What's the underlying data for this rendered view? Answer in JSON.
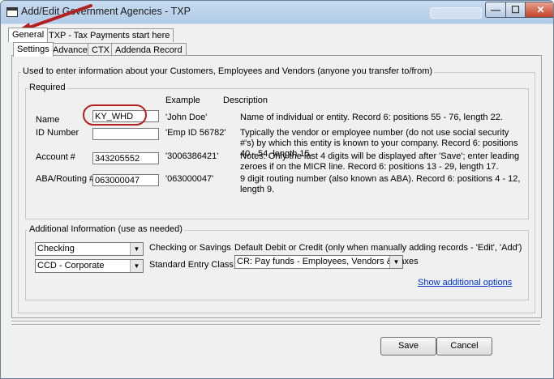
{
  "window": {
    "title": "Add/Edit Government Agencies - TXP",
    "minimize_label": "—",
    "maximize_label": "☐",
    "close_label": "✕"
  },
  "outer_tabs": [
    {
      "label": "General",
      "selected": true
    },
    {
      "label": "TXP - Tax Payments start here",
      "selected": false
    }
  ],
  "inner_tabs": [
    {
      "label": "Settings",
      "selected": true
    },
    {
      "label": "Advanced",
      "selected": false
    },
    {
      "label": "CTX",
      "selected": false
    },
    {
      "label": "Addenda Record",
      "selected": false
    }
  ],
  "main_group": {
    "legend": "Used to enter information about your Customers, Employees and Vendors (anyone you transfer to/from)"
  },
  "required": {
    "legend": "Required",
    "header_example": "Example",
    "header_description": "Description",
    "fields": [
      {
        "label": "Name",
        "value": "KY_WHD",
        "example": "'John Doe'",
        "description": "Name of individual or entity. Record 6: positions 55 - 76, length 22."
      },
      {
        "label": "ID Number",
        "value": "",
        "example": "'Emp ID 56782'",
        "description": "Typically the vendor or employee number (do not use social security #'s) by which this entity is known to your company. Record 6: positions 40 - 54, length 15."
      },
      {
        "label": "Account #",
        "value": "343205552",
        "example": "'3006386421'",
        "description": "Notes: Only the last 4 digits will be displayed after 'Save'; enter leading zeroes if on the MICR line. Record 6: positions 13 - 29, length 17."
      },
      {
        "label": "ABA/Routing #",
        "value": "063000047",
        "example": "'063000047'",
        "description": "9 digit routing number (also known as ABA). Record 6: positions 4 - 12, length 9."
      }
    ]
  },
  "additional": {
    "legend": "Additional Information (use as needed)",
    "account_type": {
      "value": "Checking",
      "label": "Checking or Savings"
    },
    "entry_class": {
      "value": "CCD - Corporate",
      "label": "Standard Entry Class"
    },
    "debit_credit": {
      "label": "Default Debit or Credit (only when manually adding records - 'Edit', 'Add')",
      "value": "CR: Pay funds - Employees, Vendors & Taxes"
    },
    "show_options_link": "Show additional options"
  },
  "buttons": {
    "save": "Save",
    "cancel": "Cancel"
  },
  "annotation": {
    "callout_color": "#b32020"
  }
}
